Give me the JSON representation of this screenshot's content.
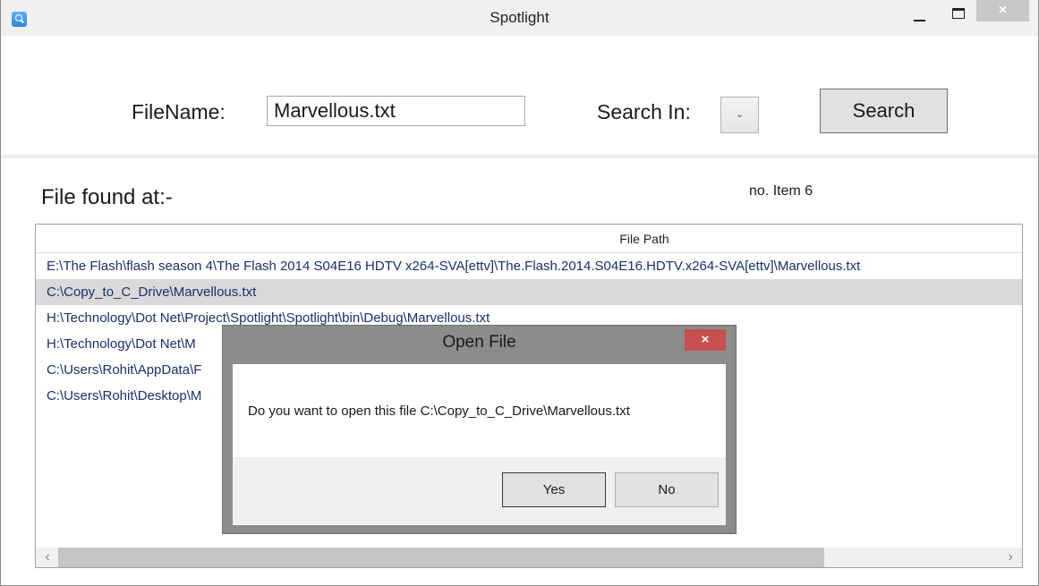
{
  "window": {
    "title": "Spotlight",
    "close_glyph": "×"
  },
  "search": {
    "filename_label": "FileName:",
    "filename_value": "Marvellous.txt",
    "search_in_label": "Search In:",
    "search_in_value": "",
    "combo_glyph": "⌄",
    "search_button": "Search"
  },
  "results": {
    "found_label": "File found at:-",
    "count_label": "no. Item 6",
    "column_header": "File Path",
    "rows": [
      "E:\\The Flash\\flash season 4\\The Flash 2014 S04E16 HDTV x264-SVA[ettv]\\The.Flash.2014.S04E16.HDTV.x264-SVA[ettv]\\Marvellous.txt",
      "C:\\Copy_to_C_Drive\\Marvellous.txt",
      "H:\\Technology\\Dot Net\\Project\\Spotlight\\Spotlight\\bin\\Debug\\Marvellous.txt",
      "H:\\Technology\\Dot Net\\M",
      "C:\\Users\\Rohit\\AppData\\F",
      "C:\\Users\\Rohit\\Desktop\\M"
    ],
    "selected_row": 1,
    "scroll_left": "‹",
    "scroll_right": "›"
  },
  "dialog": {
    "title": "Open File",
    "close_glyph": "×",
    "message": "Do you want to open this file C:\\Copy_to_C_Drive\\Marvellous.txt",
    "yes_label": "Yes",
    "no_label": "No"
  },
  "colors": {
    "row_text": "#1b2f6e",
    "selected_row_bg": "#d9d9d9",
    "dialog_close_bg": "#c75050",
    "app_icon": "#2d86e0"
  },
  "icons": {
    "app": "magnifier-icon",
    "minimize": "minimize-icon",
    "maximize": "maximize-icon",
    "close": "close-icon",
    "combo": "chevron-down-icon"
  }
}
